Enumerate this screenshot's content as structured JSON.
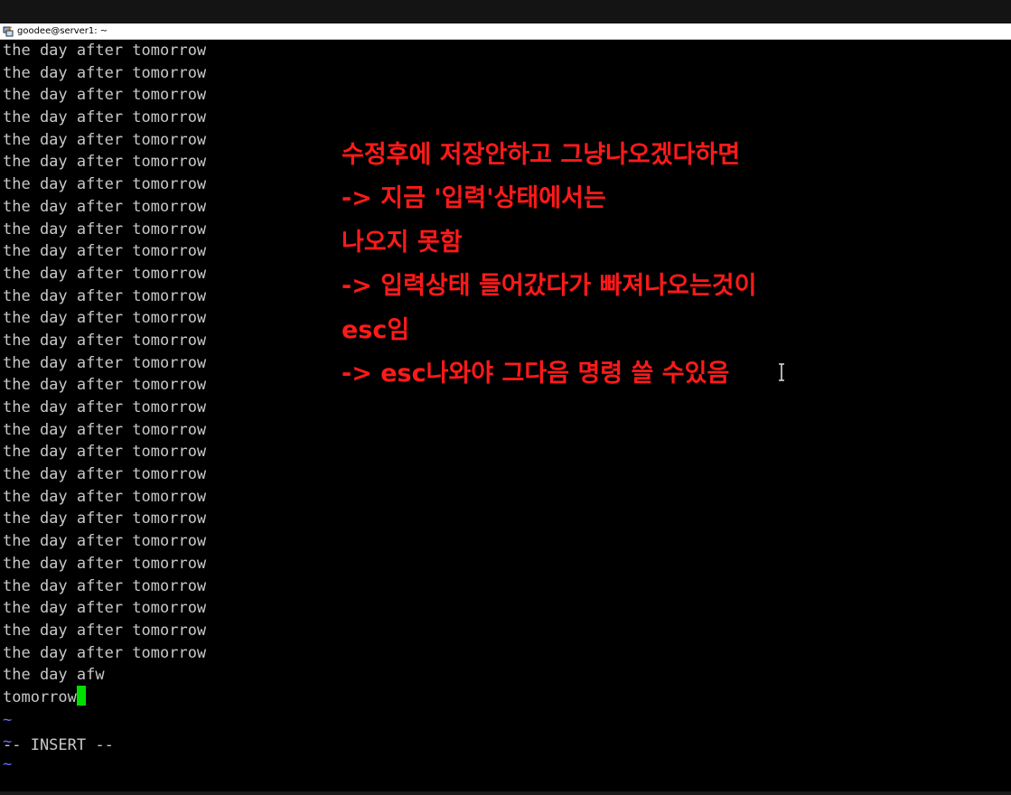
{
  "window": {
    "title": "goodee@server1: ~",
    "icon": "putty-icon"
  },
  "terminal": {
    "lines": [
      "the day after tomorrow",
      "the day after tomorrow",
      "the day after tomorrow",
      "the day after tomorrow",
      "the day after tomorrow",
      "the day after tomorrow",
      "the day after tomorrow",
      "the day after tomorrow",
      "the day after tomorrow",
      "the day after tomorrow",
      "the day after tomorrow",
      "the day after tomorrow",
      "the day after tomorrow",
      "the day after tomorrow",
      "the day after tomorrow",
      "the day after tomorrow",
      "the day after tomorrow",
      "the day after tomorrow",
      "the day after tomorrow",
      "the day after tomorrow",
      "the day after tomorrow",
      "the day after tomorrow",
      "the day after tomorrow",
      "the day after tomorrow",
      "the day after tomorrow",
      "the day after tomorrow",
      "the day after tomorrow",
      "the day after tomorrow",
      "the day afw"
    ],
    "cursor_line": "tomorrow",
    "empty_markers": [
      "~",
      "~",
      "~"
    ],
    "status": "-- INSERT --",
    "text_color": "#c8c8c8",
    "cursor_color": "#00e000",
    "tilde_color": "#6b6bff"
  },
  "annotation": {
    "color": "#ff1a1a",
    "lines": [
      "수정후에 저장안하고 그냥나오겠다하면",
      "-> 지금 '입력'상태에서는",
      "나오지 못함",
      "-> 입력상태 들어갔다가 빠져나오는것이",
      "esc임",
      "-> esc나와야 그다음 명령 쓸 수있음"
    ]
  }
}
